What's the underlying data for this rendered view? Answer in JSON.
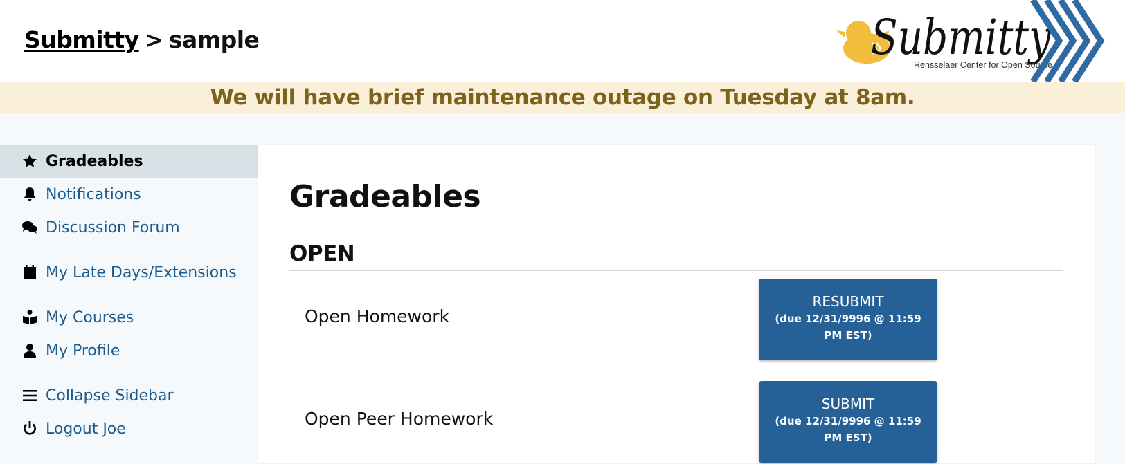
{
  "header": {
    "breadcrumb_root": "Submitty",
    "breadcrumb_separator": ">",
    "breadcrumb_course": "sample",
    "logo_text": "Submitty",
    "logo_subtitle": "Rensselaer Center for Open Source"
  },
  "banner": {
    "text": "We will have brief maintenance outage on Tuesday at 8am."
  },
  "sidebar": {
    "items": [
      {
        "label": "Gradeables",
        "icon": "star-icon"
      },
      {
        "label": "Notifications",
        "icon": "bell-icon"
      },
      {
        "label": "Discussion Forum",
        "icon": "comments-icon"
      },
      {
        "label": "My Late Days/Extensions",
        "icon": "calendar-icon"
      },
      {
        "label": "My Courses",
        "icon": "book-reader-icon"
      },
      {
        "label": "My Profile",
        "icon": "user-icon"
      },
      {
        "label": "Collapse Sidebar",
        "icon": "bars-icon"
      },
      {
        "label": "Logout Joe",
        "icon": "power-icon"
      }
    ]
  },
  "main": {
    "title": "Gradeables",
    "section": "OPEN",
    "gradeables": [
      {
        "name": "Open Homework",
        "button_label": "RESUBMIT",
        "due": "(due 12/31/9996 @ 11:59 PM EST)"
      },
      {
        "name": "Open Peer Homework",
        "button_label": "SUBMIT",
        "due": "(due 12/31/9996 @ 11:59 PM EST)"
      }
    ]
  },
  "colors": {
    "accent": "#256196",
    "link": "#1b5c8c",
    "banner_bg": "#faf0d9",
    "banner_text": "#7c621c",
    "duck": "#f2bc3c"
  }
}
